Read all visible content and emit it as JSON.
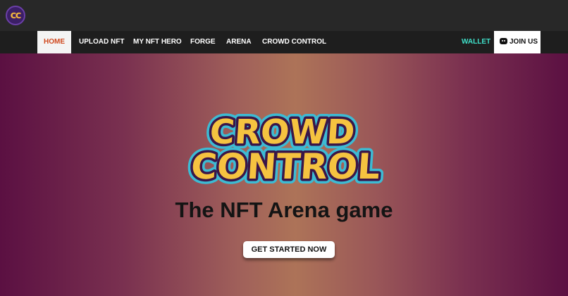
{
  "header": {
    "logo_text": "CC"
  },
  "nav": {
    "items": [
      {
        "label": "HOME"
      },
      {
        "label": "UPLOAD NFT"
      },
      {
        "label": "MY NFT HERO"
      },
      {
        "label": "FORGE"
      },
      {
        "label": "ARENA"
      },
      {
        "label": "CROWD CONTROL"
      }
    ],
    "wallet_label": "WALLET",
    "join_label": "JOIN US",
    "join_icon": "discord-icon",
    "active_item": "HOME"
  },
  "hero": {
    "logo_line1": "CROWD",
    "logo_line2": "CONTROL",
    "tagline": "The NFT Arena game",
    "cta_label": "GET STARTED NOW"
  },
  "colors": {
    "accent_active": "#d0491f",
    "wallet": "#3fe0c9",
    "logo_fill": "#f5c340",
    "logo_outline": "#3dbbd3",
    "logo_inner": "#3a1648"
  }
}
